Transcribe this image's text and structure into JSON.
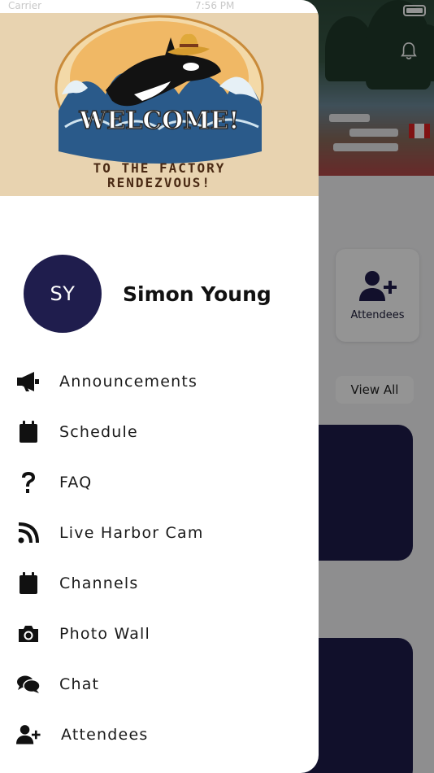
{
  "status_bar": {
    "carrier": "Carrier",
    "time": "7:56 PM"
  },
  "banner": {
    "logo_line1": "WELCOME!",
    "logo_line2": "TO THE FACTORY",
    "logo_line3": "RENDEZVOUS!",
    "background_color": "#e8d3b0"
  },
  "profile": {
    "initials": "SY",
    "name": "Simon Young",
    "avatar_color": "#1f1d4d"
  },
  "menu": {
    "items": [
      {
        "label": "Announcements",
        "icon": "megaphone-icon"
      },
      {
        "label": "Schedule",
        "icon": "calendar-icon"
      },
      {
        "label": "FAQ",
        "icon": "question-icon"
      },
      {
        "label": "Live Harbor Cam",
        "icon": "rss-icon"
      },
      {
        "label": "Channels",
        "icon": "calendar-icon"
      },
      {
        "label": "Photo Wall",
        "icon": "camera-icon"
      },
      {
        "label": "Chat",
        "icon": "chat-bubbles-icon"
      },
      {
        "label": "Attendees",
        "icon": "user-plus-icon"
      }
    ]
  },
  "background_app": {
    "attendees_label": "Attendees",
    "view_all_label": "View All",
    "card_color": "#1e1c4a"
  }
}
